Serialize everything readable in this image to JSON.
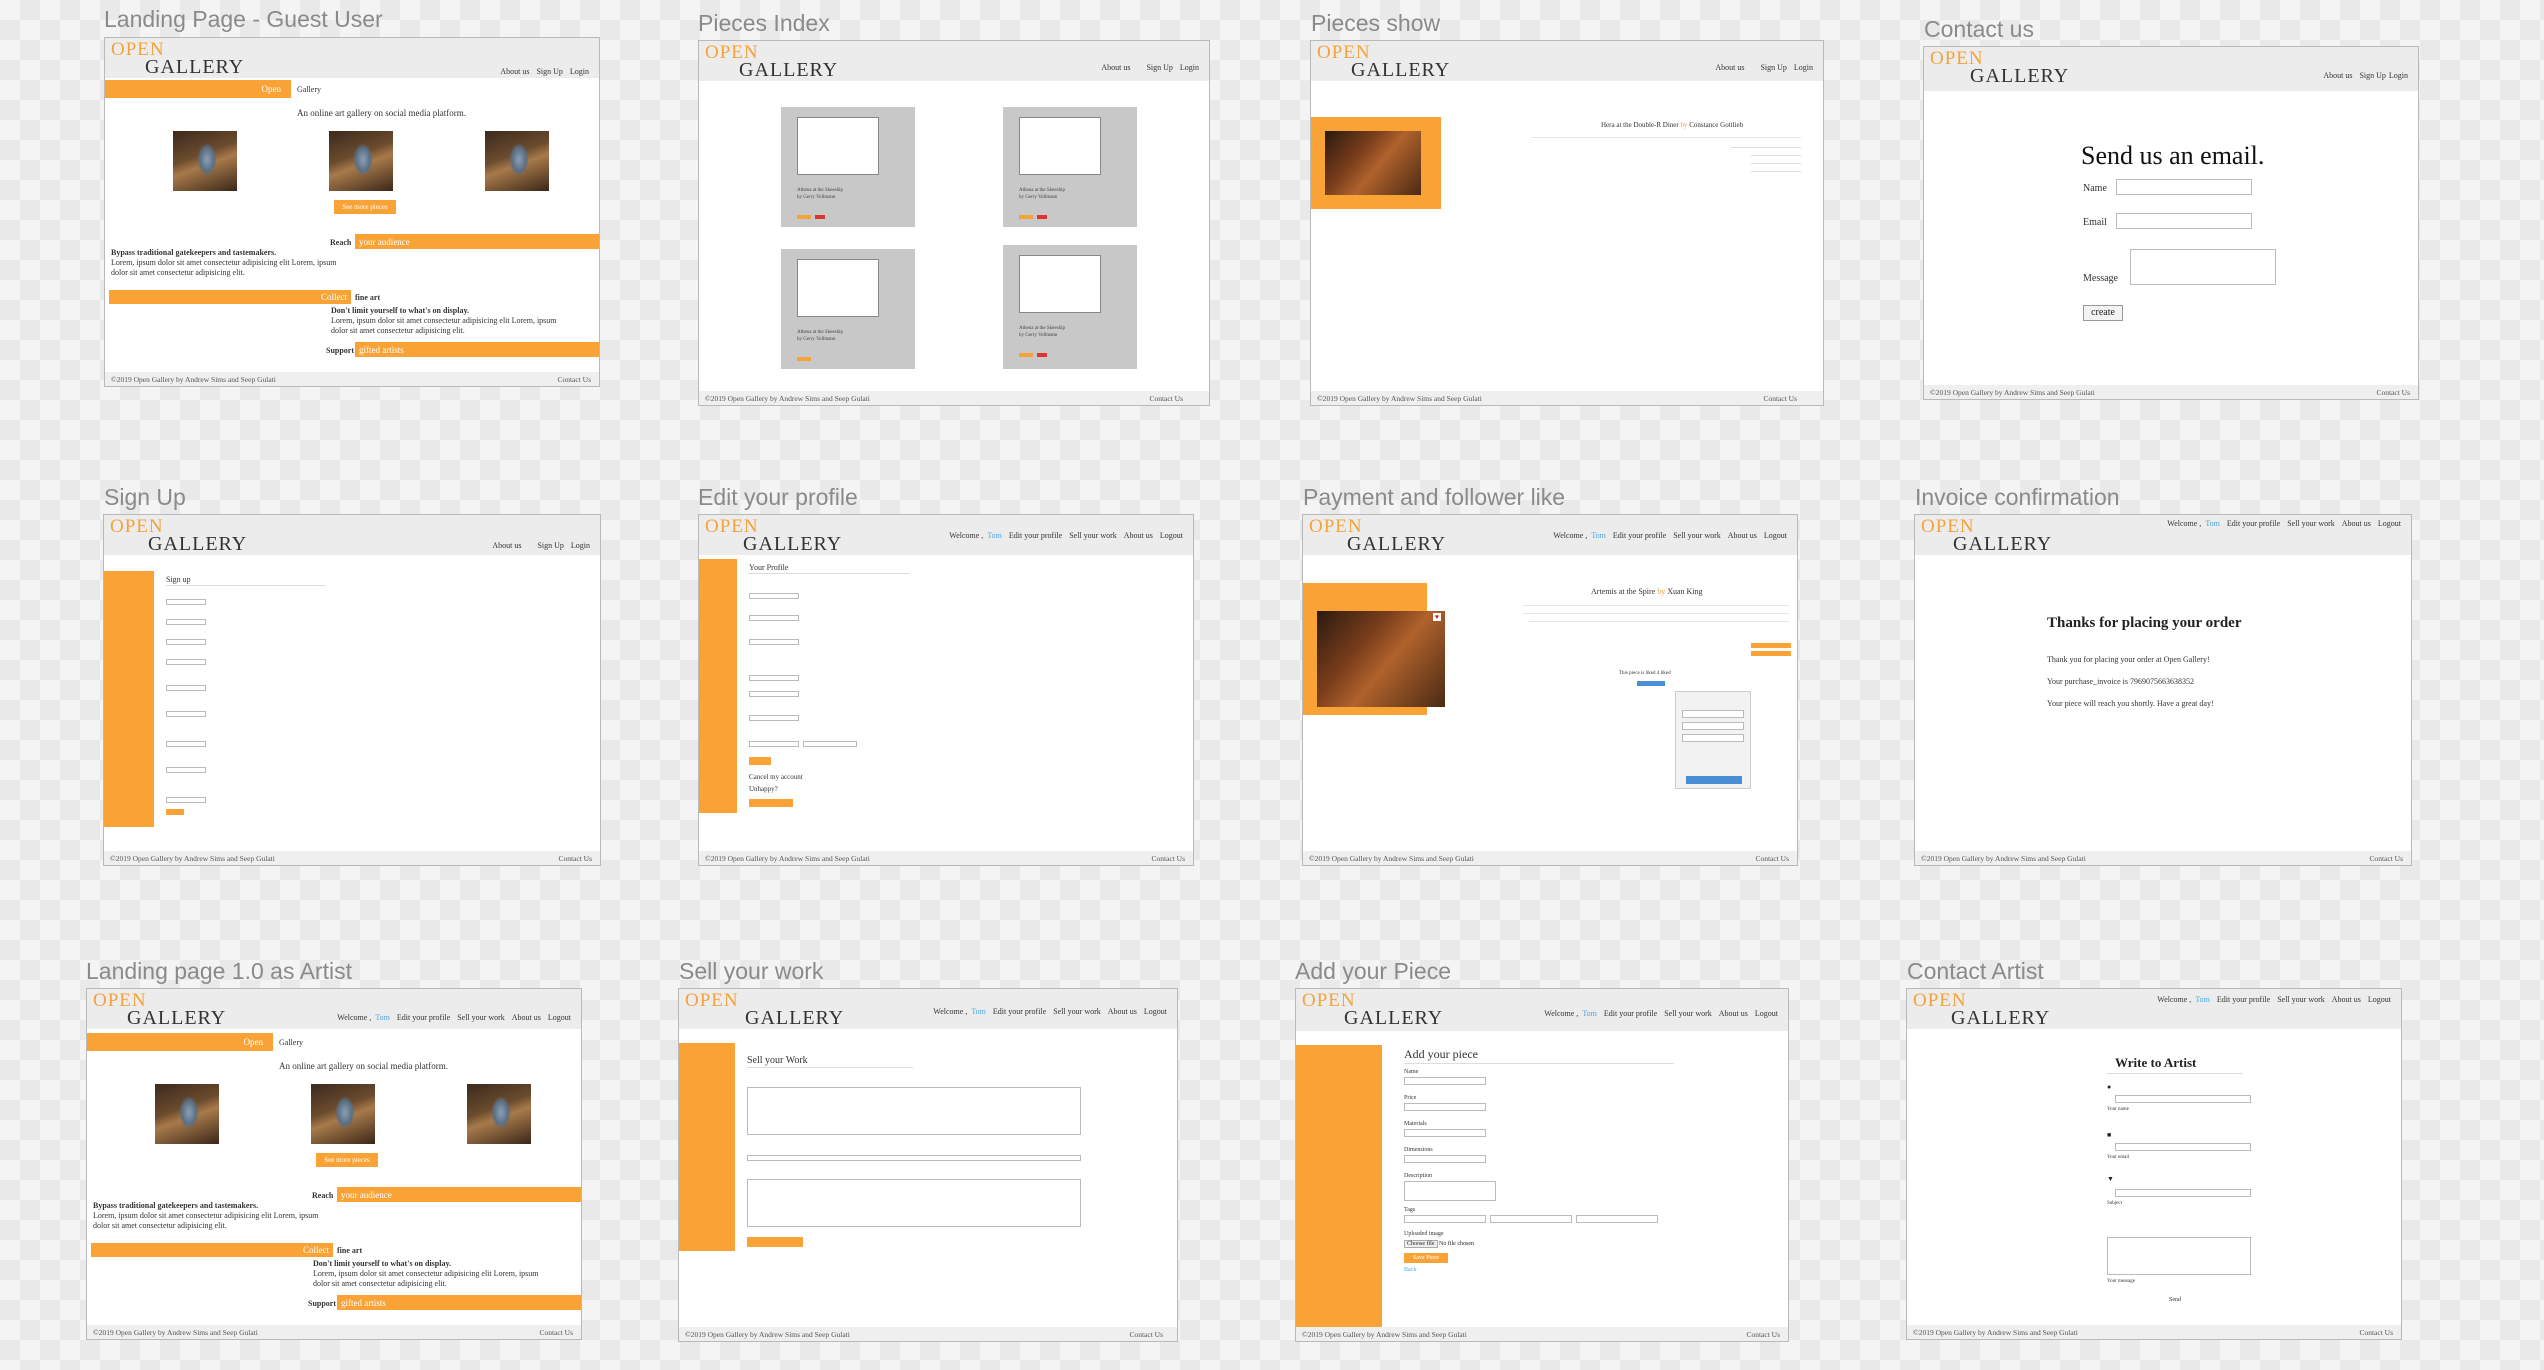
{
  "common": {
    "logo_top": "OPEN",
    "logo_bottom": "GALLERY",
    "footer_left": "©2019 Open Gallery by Andrew Sims and Seep Gulati",
    "footer_right": "Contact Us",
    "nav_guest": [
      "About us",
      "Sign Up",
      "Login"
    ],
    "nav_user": [
      "Edit your profile",
      "Sell your work",
      "About us",
      "Logout"
    ],
    "welcome": "Welcome ,",
    "username": "Tom",
    "by": "by"
  },
  "landing": {
    "guest_title": "Landing Page - Guest User",
    "artist_title": "Landing page 1.0 as Artist",
    "open_tag": "Open",
    "gallery_word": "Gallery",
    "tagline": "An online art gallery on social media platform.",
    "see_more": "See more pieces",
    "reach": "Reach",
    "your_audience": "your audience",
    "bypass": "Bypass traditional gatekeepers and tastemakers.",
    "lorem1": "Lorem, ipsum dolor sit amet consectetur adipisicing elit Lorem, ipsum",
    "lorem1b": "dolor sit amet consectetur adipisicing elit.",
    "collect": "Collect",
    "fine_art": "fine art",
    "dont_limit": "Don't limit yourself to what's on display.",
    "lorem2": "Lorem, ipsum dolor sit amet consectetur adipisicing elit Lorem, ipsum",
    "lorem2b": "dolor sit amet consectetur adipisicing elit.",
    "support": "Support",
    "gifted": "gifted artists"
  },
  "pieces_index": {
    "title": "Pieces Index",
    "card_line1": "Athena at the Skeeship",
    "card_line2": "by Gerry Vollmann"
  },
  "pieces_show": {
    "title": "Pieces show",
    "art_title": "Hera at the Double-R Diner",
    "artist": "Constance Gottlieb"
  },
  "contact_us": {
    "title": "Contact us",
    "heading": "Send us an email.",
    "name_label": "Name",
    "email_label": "Email",
    "message_label": "Message",
    "create": "create"
  },
  "sign_up": {
    "title": "Sign Up",
    "heading": "Sign up"
  },
  "edit_profile": {
    "title": "Edit your profile",
    "heading": "Your Profile",
    "cancel": "Cancel my account",
    "unhappy": "Unhappy?"
  },
  "payment": {
    "title": "Payment and follower like",
    "art_title": "Artemis at the Spire",
    "artist": "Xuan King",
    "liked": "This piece is liked 4 likes!"
  },
  "invoice": {
    "title": "Invoice confirmation",
    "heading": "Thanks for placing your order",
    "line1": "Thank you for placing your order at Open Gallery!",
    "line2": "Your purchase_invoice is 7969075663638352",
    "line3": "Your piece will reach you shortly. Have a great day!"
  },
  "sell": {
    "title": "Sell your work",
    "heading": "Sell your Work"
  },
  "add_piece": {
    "title": "Add your Piece",
    "heading": "Add your piece",
    "labels": [
      "Name",
      "Price",
      "Materials",
      "Dimensions",
      "Description",
      "Tags",
      "Uploaded image"
    ],
    "choose_file": "Choose file",
    "no_file": "No file chosen",
    "save": "Save Piece",
    "back": "Back"
  },
  "contact_artist": {
    "title": "Contact Artist",
    "heading": "Write to Artist",
    "name_hint": "Your name",
    "email_hint": "Your email",
    "subject_hint": "Subject",
    "message_hint": "Your message",
    "send": "Send"
  }
}
